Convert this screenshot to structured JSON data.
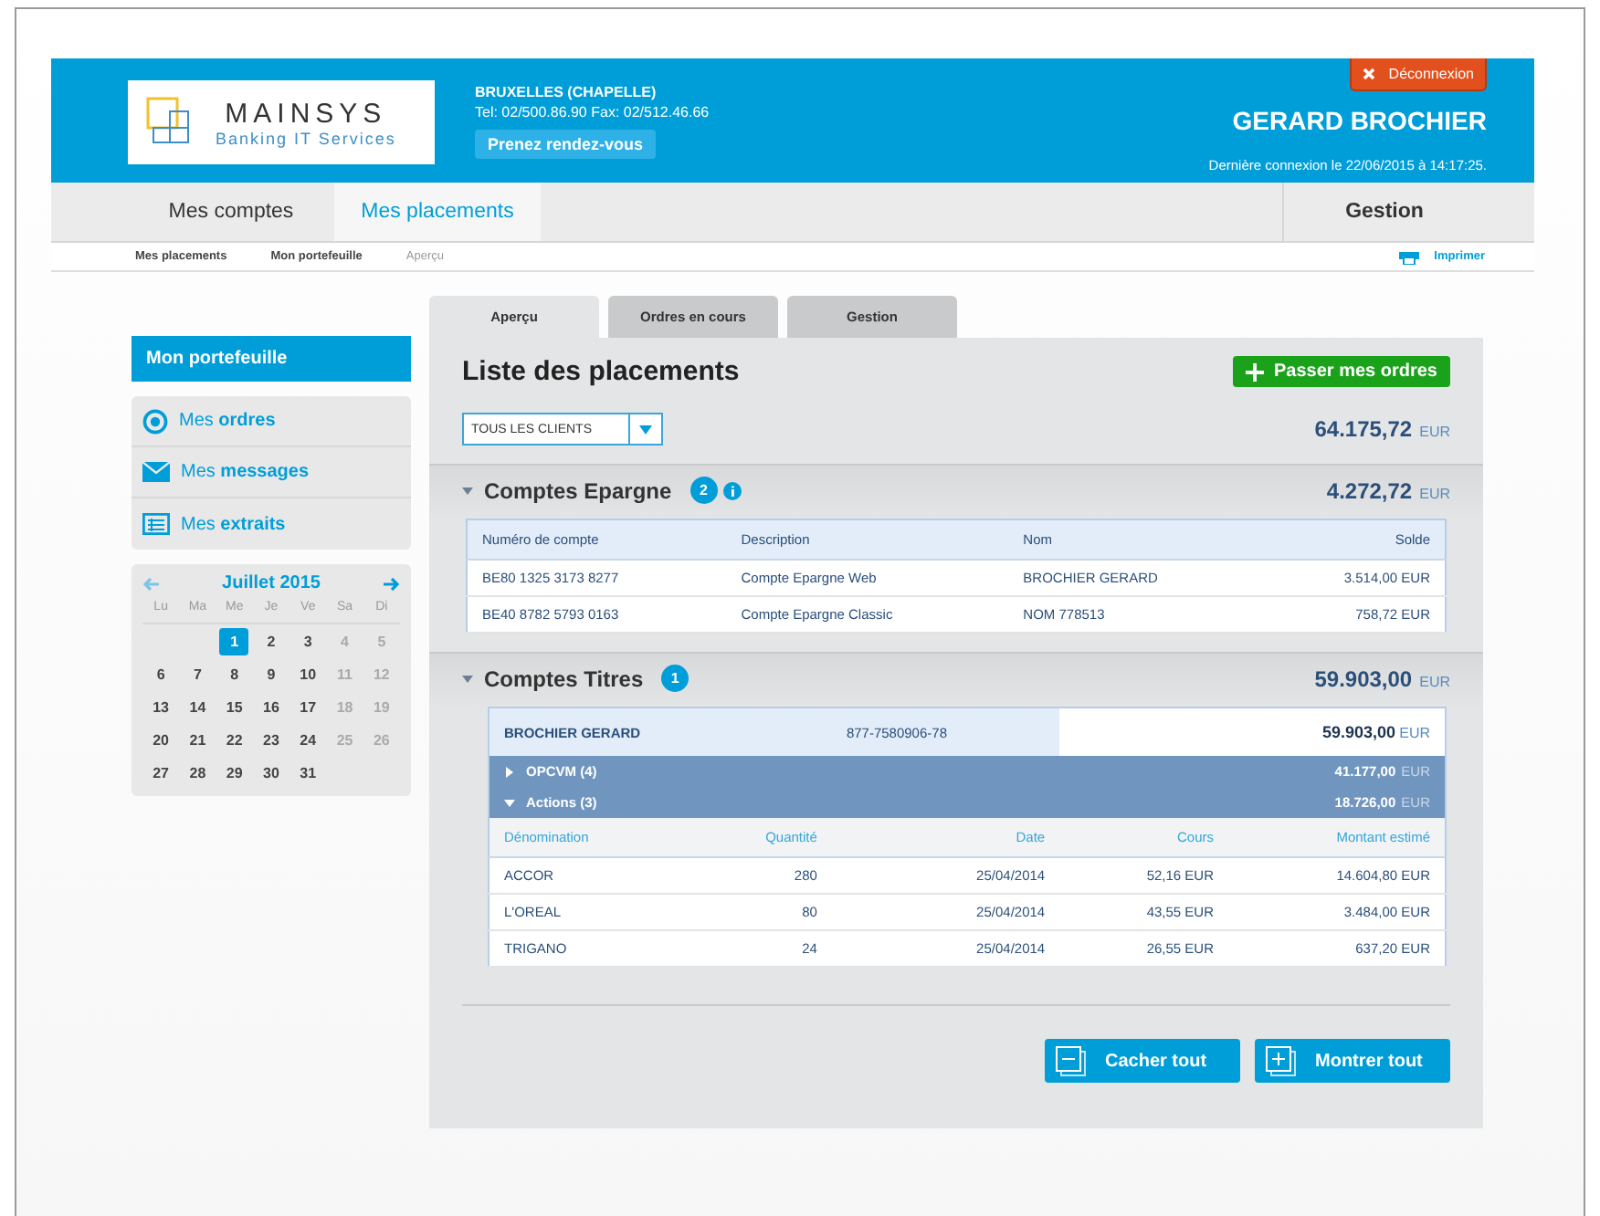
{
  "header": {
    "logo": {
      "name": "MAINSYS",
      "tagline": "Banking IT Services"
    },
    "branch": "BRUXELLES (CHAPELLE)",
    "contact": "Tel: 02/500.86.90 Fax: 02/512.46.66",
    "appointment_button": "Prenez rendez-vous",
    "logout_button": "Déconnexion",
    "user": "GERARD BROCHIER",
    "last_login": "Dernière connexion le 22/06/2015 à 14:17:25."
  },
  "nav": [
    {
      "label": "Mes comptes",
      "selected": false
    },
    {
      "label": "Mes placements",
      "selected": true
    }
  ],
  "nav_right": "Gestion",
  "breadcrumb": [
    {
      "label": "Mes placements",
      "current": false
    },
    {
      "label": "Mon portefeuille",
      "current": false
    },
    {
      "label": "Aperçu",
      "current": true
    }
  ],
  "print_link": "Imprimer",
  "sidebar": {
    "title": "Mon portefeuille",
    "items": [
      {
        "kind": "target",
        "label": "Mes **ordres**"
      },
      {
        "kind": "mail",
        "label": "Mes **messages**"
      },
      {
        "kind": "list",
        "label": "Mes **extraits**"
      }
    ],
    "calendar": {
      "month": "Juillet 2015",
      "weekdays": [
        "Lu",
        "Ma",
        "Me",
        "Je",
        "Ve",
        "Sa",
        "Di"
      ],
      "weeks": [
        [
          {
            "day": "1",
            "selected": true,
            "weekend": false
          },
          {
            "day": "2",
            "selected": false,
            "weekend": false
          },
          {
            "day": "3",
            "selected": false,
            "weekend": false
          },
          {
            "day": "4",
            "selected": false,
            "weekend": true
          },
          {
            "day": "5",
            "selected": false,
            "weekend": true
          }
        ],
        [
          {
            "day": "6",
            "selected": false,
            "weekend": false
          },
          {
            "day": "7",
            "selected": false,
            "weekend": false
          },
          {
            "day": "8",
            "selected": false,
            "weekend": false
          },
          {
            "day": "9",
            "selected": false,
            "weekend": false
          },
          {
            "day": "10",
            "selected": false,
            "weekend": false
          },
          {
            "day": "11",
            "selected": false,
            "weekend": true
          },
          {
            "day": "12",
            "selected": false,
            "weekend": true
          }
        ],
        [
          {
            "day": "13",
            "selected": false,
            "weekend": false
          },
          {
            "day": "14",
            "selected": false,
            "weekend": false
          },
          {
            "day": "15",
            "selected": false,
            "weekend": false
          },
          {
            "day": "16",
            "selected": false,
            "weekend": false
          },
          {
            "day": "17",
            "selected": false,
            "weekend": false
          },
          {
            "day": "18",
            "selected": false,
            "weekend": true
          },
          {
            "day": "19",
            "selected": false,
            "weekend": true
          }
        ],
        [
          {
            "day": "20",
            "selected": false,
            "weekend": false
          },
          {
            "day": "21",
            "selected": false,
            "weekend": false
          },
          {
            "day": "22",
            "selected": false,
            "weekend": false
          },
          {
            "day": "23",
            "selected": false,
            "weekend": false
          },
          {
            "day": "24",
            "selected": false,
            "weekend": false
          },
          {
            "day": "25",
            "selected": false,
            "weekend": true
          },
          {
            "day": "26",
            "selected": false,
            "weekend": true
          }
        ],
        [
          {
            "day": "27",
            "selected": false,
            "weekend": false
          },
          {
            "day": "28",
            "selected": false,
            "weekend": false
          },
          {
            "day": "29",
            "selected": false,
            "weekend": false
          },
          {
            "day": "30",
            "selected": false,
            "weekend": false
          },
          {
            "day": "31",
            "selected": false,
            "weekend": false
          }
        ]
      ]
    }
  },
  "tabs": [
    {
      "label": "Aperçu",
      "selected": true
    },
    {
      "label": "Ordres en cours",
      "selected": false
    },
    {
      "label": "Gestion",
      "selected": false
    }
  ],
  "main": {
    "title": "Liste des placements",
    "order_button": "Passer mes ordres",
    "client_select": "TOUS LES CLIENTS",
    "total": "64.175,72",
    "total_currency": "EUR",
    "savings": {
      "title": "Comptes Epargne",
      "count": "2",
      "total": "4.272,72",
      "currency": "EUR",
      "expanded": true,
      "columns": [
        "Numéro de compte",
        "Description",
        "Nom",
        "Solde"
      ],
      "rows": [
        [
          "BE80 1325 3173 8277",
          "Compte Epargne Web",
          "BROCHIER GERARD",
          "3.514,00 EUR"
        ],
        [
          "BE40 8782 5793 0163",
          "Compte Epargne Classic",
          "NOM 778513",
          "758,72 EUR"
        ]
      ]
    },
    "securities": {
      "title": "Comptes Titres",
      "count": "1",
      "total": "59.903,00",
      "currency": "EUR",
      "expanded": true,
      "account": {
        "holder": "BROCHIER GERARD",
        "number": "877-7580906-78",
        "amount": "59.903,00",
        "currency": "EUR"
      },
      "groups": [
        {
          "label": "OPCVM (4)",
          "amount": "41.177,00",
          "currency": "EUR",
          "expanded": false
        },
        {
          "label": "Actions (3)",
          "amount": "18.726,00",
          "currency": "EUR",
          "expanded": true
        }
      ],
      "columns": [
        "Dénomination",
        "Quantité",
        "Date",
        "Cours",
        "Montant estimé"
      ],
      "rows": [
        [
          "ACCOR",
          "280",
          "25/04/2014",
          "52,16 EUR",
          "14.604,80 EUR"
        ],
        [
          "L'OREAL",
          "80",
          "25/04/2014",
          "43,55 EUR",
          "3.484,00 EUR"
        ],
        [
          "TRIGANO",
          "24",
          "25/04/2014",
          "26,55 EUR",
          "637,20 EUR"
        ]
      ]
    },
    "collapse_button": "Cacher tout",
    "expand_button": "Montrer tout"
  }
}
